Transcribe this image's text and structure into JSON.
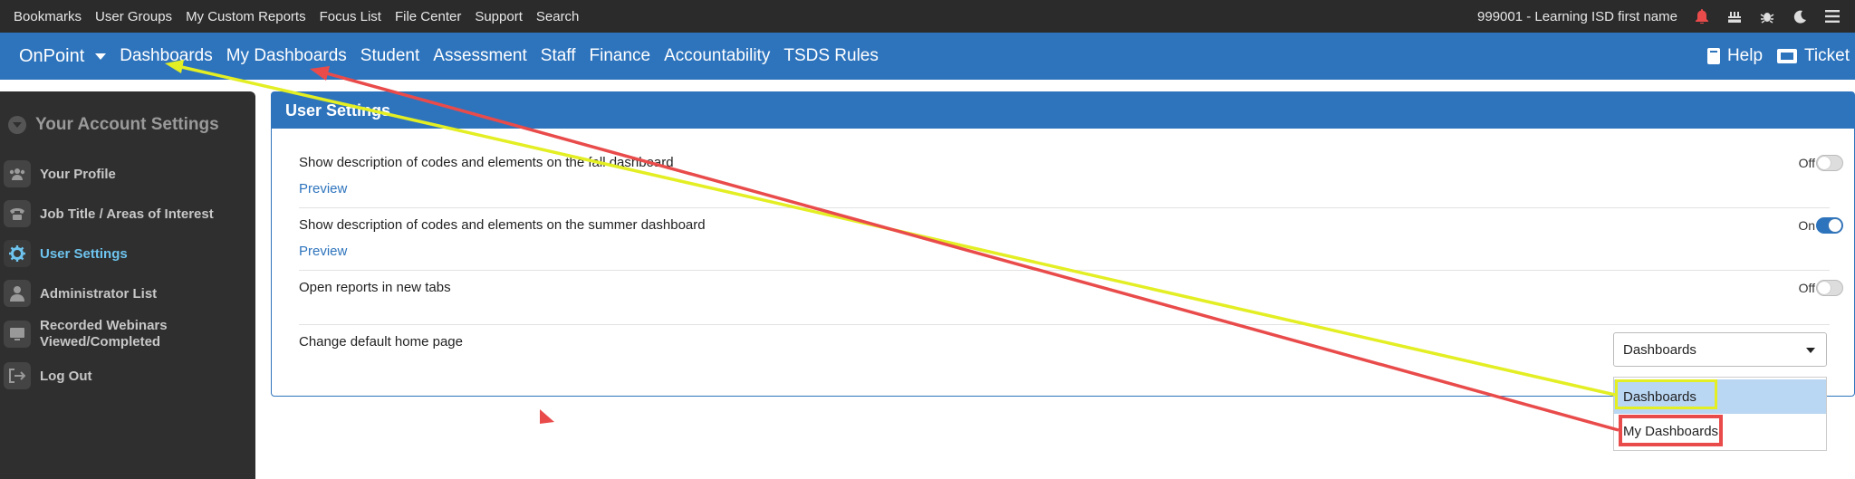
{
  "topbar": {
    "links": [
      "Bookmarks",
      "User Groups",
      "My Custom Reports",
      "Focus List",
      "File Center",
      "Support",
      "Search"
    ],
    "user": "999001 - Learning ISD first name",
    "icons": [
      "bell-icon",
      "cake-icon",
      "bug-icon",
      "moon-icon",
      "menu-icon"
    ]
  },
  "mainnav": {
    "brand": "OnPoint",
    "items": [
      "Dashboards",
      "My Dashboards",
      "Student",
      "Assessment",
      "Staff",
      "Finance",
      "Accountability",
      "TSDS Rules"
    ],
    "help": "Help",
    "ticket": "Ticket"
  },
  "sidebar": {
    "title": "Your Account Settings",
    "items": [
      {
        "label": "Your Profile",
        "icon": "users-icon"
      },
      {
        "label": "Job Title / Areas of Interest",
        "icon": "phone-icon"
      },
      {
        "label": "User Settings",
        "icon": "gear-icon"
      },
      {
        "label": "Administrator List",
        "icon": "admin-icon"
      },
      {
        "label": "Recorded Webinars Viewed/Completed",
        "icon": "webinar-icon"
      },
      {
        "label": "Log Out",
        "icon": "logout-icon"
      }
    ]
  },
  "panel": {
    "title": "User Settings",
    "settings": [
      {
        "label": "Show description of codes and elements on the fall dashboard",
        "preview": "Preview",
        "state": "Off"
      },
      {
        "label": "Show description of codes and elements on the summer dashboard",
        "preview": "Preview",
        "state": "On"
      },
      {
        "label": "Open reports in new tabs",
        "state": "Off"
      }
    ],
    "home_page": {
      "label": "Change default home page",
      "selected": "Dashboards",
      "options": [
        "Dashboards",
        "My Dashboards"
      ]
    }
  },
  "colors": {
    "accent": "#2e74bd",
    "annotation_yellow": "#e3ee23",
    "annotation_red": "#e94b4b"
  }
}
